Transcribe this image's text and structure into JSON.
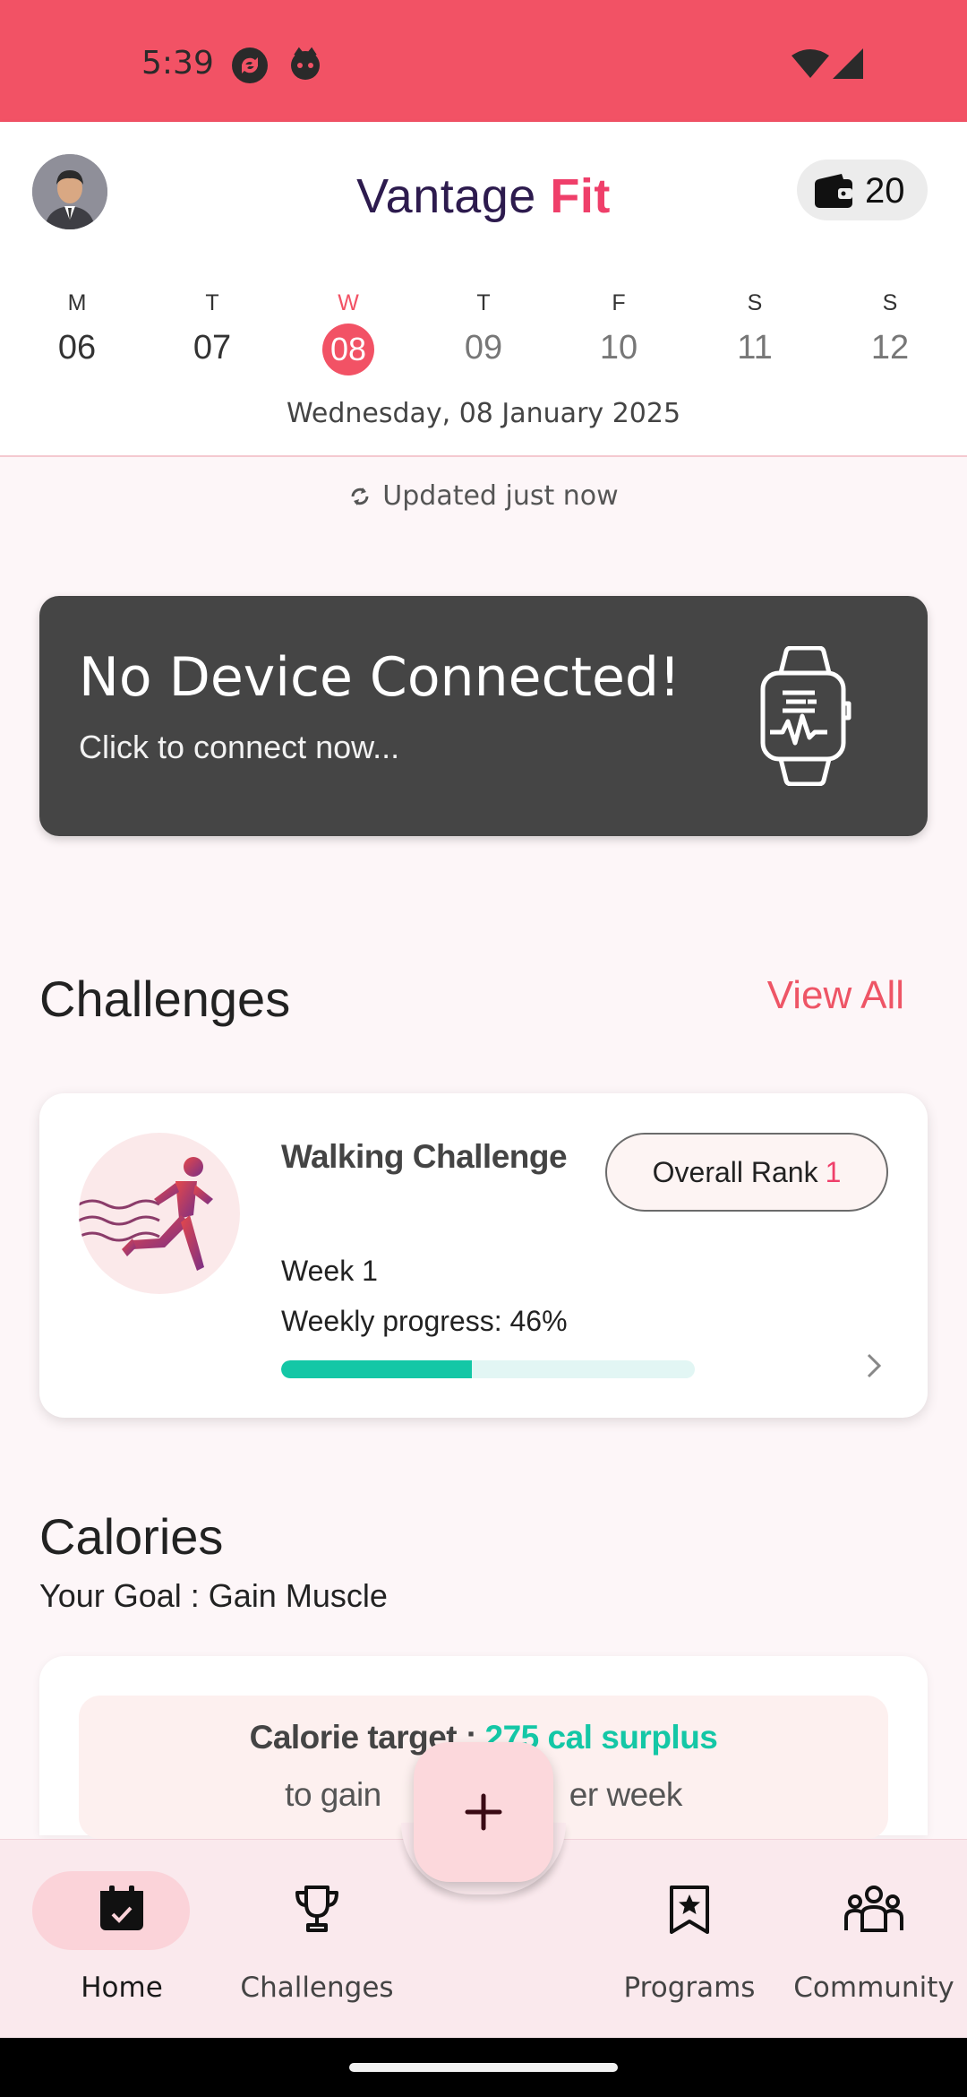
{
  "status_bar": {
    "time": "5:39",
    "bg_color": "#f25265",
    "icons": [
      "sync-status-icon",
      "face-notification-icon",
      "wifi-icon",
      "signal-icon"
    ]
  },
  "header": {
    "brand_primary": "Vantage",
    "brand_accent": "Fit",
    "wallet_count": "20"
  },
  "week": {
    "days": [
      {
        "letter": "M",
        "num": "06"
      },
      {
        "letter": "T",
        "num": "07"
      },
      {
        "letter": "W",
        "num": "08"
      },
      {
        "letter": "T",
        "num": "09"
      },
      {
        "letter": "F",
        "num": "10"
      },
      {
        "letter": "S",
        "num": "11"
      },
      {
        "letter": "S",
        "num": "12"
      }
    ],
    "selected_index": 2,
    "full_date": "Wednesday, 08 January 2025"
  },
  "updated_text": "Updated just now",
  "device_card": {
    "title": "No Device Connected!",
    "subtitle": "Click to connect now..."
  },
  "challenges": {
    "title": "Challenges",
    "view_all": "View All",
    "card": {
      "name": "Walking Challenge",
      "rank_label": "Overall Rank",
      "rank_value": "1",
      "week": "Week 1",
      "progress_text": "Weekly progress: 46%",
      "progress": 0.46
    }
  },
  "calories": {
    "title": "Calories",
    "goal": "Your Goal : Gain Muscle",
    "target_label": "Calorie target :",
    "target_value": "275 cal surplus",
    "line2_left": "to gain",
    "line2_right": "er week"
  },
  "nav": {
    "items": [
      {
        "label": "Home",
        "icon": "calendar-check-icon"
      },
      {
        "label": "Challenges",
        "icon": "trophy-icon"
      },
      {
        "label": "Programs",
        "icon": "bookmark-star-icon"
      },
      {
        "label": "Community",
        "icon": "community-icon"
      }
    ],
    "fab_icon": "plus-icon"
  },
  "colors": {
    "accent": "#f25265",
    "brand_accent": "#ef3f6a",
    "progress": "#14c7a6",
    "device_card_bg": "#454545"
  }
}
